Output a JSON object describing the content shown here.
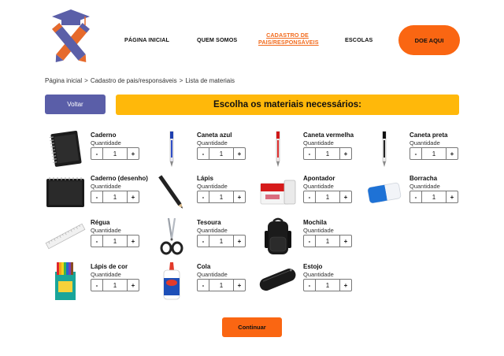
{
  "header": {
    "logo_icon": "graduation-cap-pencils-logo",
    "nav": [
      {
        "label": "PÁGINA INICIAL"
      },
      {
        "label": "QUEM SOMOS"
      },
      {
        "label_line1": "CADASTRO DE",
        "label_line2": "PAIS/RESPONSÁVEIS",
        "active": true
      },
      {
        "label": "ESCOLAS"
      }
    ],
    "donate_label": "DOE AQUI"
  },
  "breadcrumb": {
    "items": [
      "Página inicial",
      ">",
      "Cadastro de pais/responsáveis",
      ">",
      "Lista de materiais"
    ]
  },
  "back_label": "Voltar",
  "banner_title": "Escolha os materiais necessários:",
  "quantity_label": "Quantidade",
  "materials": [
    {
      "name": "Caderno",
      "qty": "1",
      "icon": "notebook-icon"
    },
    {
      "name": "Caneta azul",
      "qty": "1",
      "icon": "blue-pen-icon"
    },
    {
      "name": "Caneta vermelha",
      "qty": "1",
      "icon": "red-pen-icon"
    },
    {
      "name": "Caneta preta",
      "qty": "1",
      "icon": "black-pen-icon"
    },
    {
      "name": "Caderno (desenho)",
      "qty": "1",
      "icon": "sketchbook-icon"
    },
    {
      "name": "Lápis",
      "qty": "1",
      "icon": "pencil-icon"
    },
    {
      "name": "Apontador",
      "qty": "1",
      "icon": "sharpener-icon"
    },
    {
      "name": "Borracha",
      "qty": "1",
      "icon": "eraser-icon"
    },
    {
      "name": "Régua",
      "qty": "1",
      "icon": "ruler-icon"
    },
    {
      "name": "Tesoura",
      "qty": "1",
      "icon": "scissors-icon"
    },
    {
      "name": "Mochila",
      "qty": "1",
      "icon": "backpack-icon"
    },
    {
      "name": "Lápis de cor",
      "qty": "1",
      "icon": "colored-pencils-icon"
    },
    {
      "name": "Cola",
      "qty": "1",
      "icon": "glue-icon"
    },
    {
      "name": "Estojo",
      "qty": "1",
      "icon": "pencil-case-icon"
    }
  ],
  "stepper": {
    "minus": "-",
    "plus": "+"
  },
  "continue_label": "Continuar",
  "colors": {
    "orange": "#fa6612",
    "yellow": "#ffb80a",
    "purple": "#5a5ea8"
  }
}
